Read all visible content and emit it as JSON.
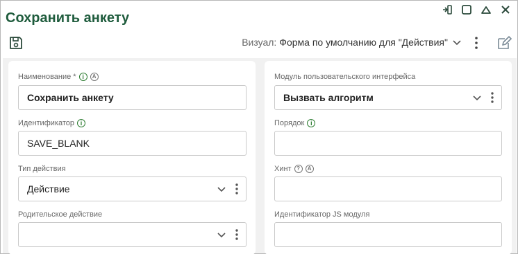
{
  "window": {
    "title": "Сохранить анкету",
    "controls": [
      "pin-icon",
      "maximize-icon",
      "collapse-icon",
      "close-icon"
    ]
  },
  "toolbar": {
    "save_icon": "save-icon",
    "visual_label": "Визуал:",
    "visual_value": "Форма по умолчанию для \"Действия\"",
    "more_icon": "kebab-icon",
    "edit_icon": "edit-icon"
  },
  "form": {
    "left": {
      "name": {
        "label": "Наименование *",
        "value": "Сохранить анкету"
      },
      "identifier": {
        "label": "Идентификатор",
        "value": "SAVE_BLANK"
      },
      "action_type": {
        "label": "Тип действия",
        "value": "Действие"
      },
      "parent_action": {
        "label": "Родительское действие",
        "value": ""
      }
    },
    "right": {
      "ui_module": {
        "label": "Модуль пользовательского интерфейса",
        "value": "Вызвать алгоритм"
      },
      "order": {
        "label": "Порядок",
        "value": ""
      },
      "hint": {
        "label": "Хинт",
        "value": ""
      },
      "js_module_id": {
        "label": "Идентификатор JS модуля",
        "value": ""
      }
    }
  },
  "colors": {
    "brand": "#1f5c3d",
    "info": "#2e7d32",
    "border": "#c9c9c9",
    "panel_bg": "#f1f1f1"
  }
}
